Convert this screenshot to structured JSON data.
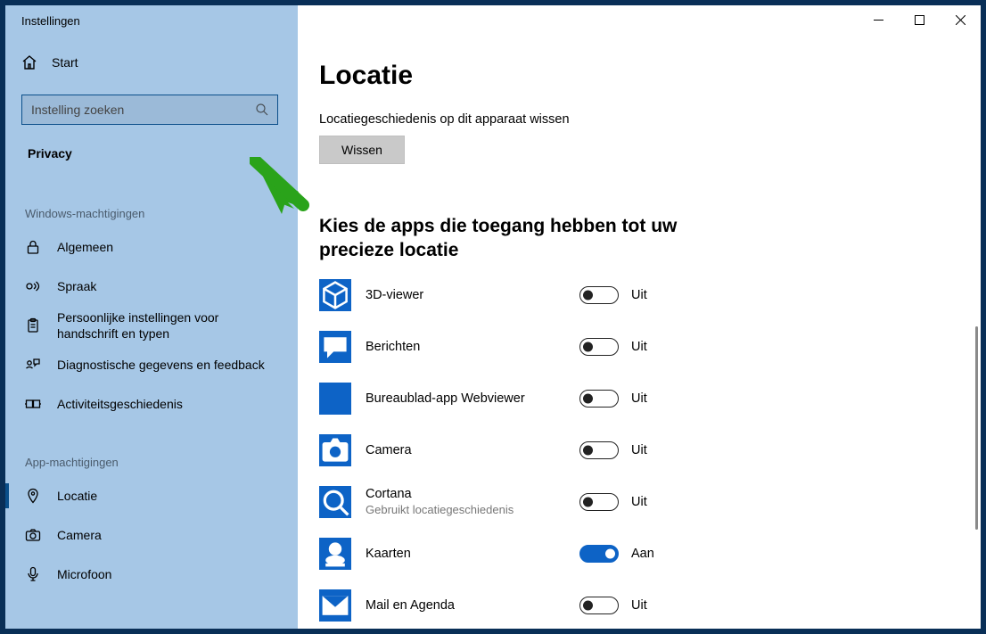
{
  "window": {
    "title": "Instellingen"
  },
  "sidebar": {
    "home": "Start",
    "search_placeholder": "Instelling zoeken",
    "category": "Privacy",
    "group1_caption": "Windows-machtigingen",
    "group1": [
      {
        "label": "Algemeen"
      },
      {
        "label": "Spraak"
      },
      {
        "label": "Persoonlijke instellingen voor handschrift en typen"
      },
      {
        "label": "Diagnostische gegevens en feedback"
      },
      {
        "label": "Activiteitsgeschiedenis"
      }
    ],
    "group2_caption": "App-machtigingen",
    "group2": [
      {
        "label": "Locatie"
      },
      {
        "label": "Camera"
      },
      {
        "label": "Microfoon"
      }
    ]
  },
  "main": {
    "title": "Locatie",
    "history_caption": "Locatiegeschiedenis op dit apparaat wissen",
    "clear_button": "Wissen",
    "choose_apps_heading": "Kies de apps die toegang hebben tot uw precieze locatie",
    "state_on": "Aan",
    "state_off": "Uit",
    "apps": [
      {
        "name": "3D-viewer",
        "on": false
      },
      {
        "name": "Berichten",
        "on": false
      },
      {
        "name": "Bureaublad-app Webviewer",
        "on": false
      },
      {
        "name": "Camera",
        "on": false
      },
      {
        "name": "Cortana",
        "sub": "Gebruikt locatiegeschiedenis",
        "on": false
      },
      {
        "name": "Kaarten",
        "on": true
      },
      {
        "name": "Mail en Agenda",
        "on": false
      }
    ]
  }
}
